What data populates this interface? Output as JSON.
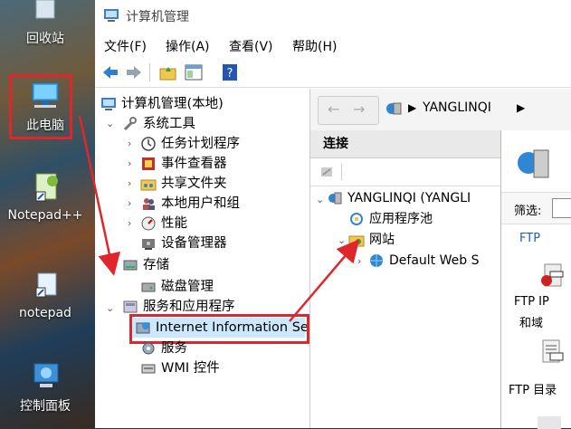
{
  "desktop": {
    "recycle_bin": "回收站",
    "this_pc": "此电脑",
    "notepadpp": "Notepad++",
    "notepad": "notepad",
    "control_panel": "控制面板"
  },
  "window": {
    "title": "计算机管理",
    "menu": [
      "文件(F)",
      "操作(A)",
      "查看(V)",
      "帮助(H)"
    ]
  },
  "tree": {
    "root": "计算机管理(本地)",
    "system_tools": "系统工具",
    "task_scheduler": "任务计划程序",
    "event_viewer": "事件查看器",
    "shared_folders": "共享文件夹",
    "local_users": "本地用户和组",
    "performance": "性能",
    "device_manager": "设备管理器",
    "storage": "存储",
    "disk_management": "磁盘管理",
    "services_apps": "服务和应用程序",
    "iis": "Internet Information Se",
    "services": "服务",
    "wmi": "WMI 控件"
  },
  "iis": {
    "address": "YANGLINQI",
    "connections_header": "连接",
    "server_node": "YANGLINQI (YANGLI",
    "app_pools": "应用程序池",
    "sites": "网站",
    "default_site": "Default Web S",
    "filter_label": "筛选:",
    "ftp_label": "FTP",
    "ftp_ip_line1": "FTP IP",
    "ftp_ip_line2": "和域",
    "ftp_dir": "FTP 目录"
  },
  "colors": {
    "highlight": "#e0262b",
    "tree_selected": "#cce8ff"
  }
}
